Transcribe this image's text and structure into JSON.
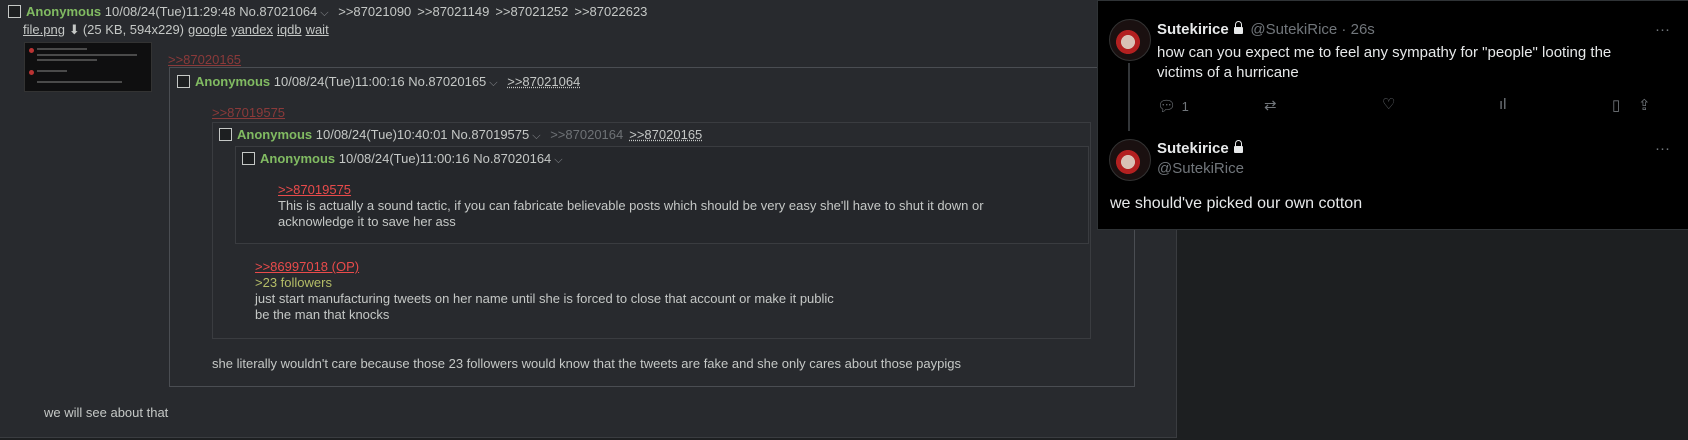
{
  "main_post": {
    "name": "Anonymous",
    "datetime": "10/08/24(Tue)11:29:48",
    "post_no": "No.87021064",
    "backlinks": [
      ">>87021090",
      ">>87021149",
      ">>87021252",
      ">>87022623"
    ],
    "file_name": "file.png",
    "file_meta": "(25 KB, 594x229)",
    "file_links": [
      "google",
      "yandex",
      "iqdb",
      "wait"
    ],
    "quote_dead": ">>87020165",
    "comment": "we will see about that"
  },
  "reply_1": {
    "name": "Anonymous",
    "datetime": "10/08/24(Tue)11:00:16",
    "post_no": "No.87020165",
    "backlink": ">>87021064",
    "quote_dead": ">>87019575",
    "comment": "she literally wouldn't care because those 23 followers would know that the tweets are fake and she only cares about those paypigs"
  },
  "reply_2": {
    "name": "Anonymous",
    "datetime": "10/08/24(Tue)10:40:01",
    "post_no": "No.87019575",
    "backlink_dim": ">>87020164",
    "backlink": ">>87020165",
    "quote_op": ">>86997018 (OP)",
    "greentext": ">23 followers",
    "comment_line1": "just start manufacturing tweets on her name until she is forced to close that account or make it public",
    "comment_line2": "be the man that knocks"
  },
  "reply_3": {
    "name": "Anonymous",
    "datetime": "10/08/24(Tue)11:00:16",
    "post_no": "No.87020164",
    "quote": ">>87019575",
    "comment": "This is actually a sound tactic, if you can fabricate believable posts which should be very easy she'll have to shut it down or acknowledge it to save her ass"
  },
  "tweet": {
    "first": {
      "display_name": "Sutekirice",
      "handle_time": "@SutekiRice · 26s",
      "text": "how can you expect me to feel any sympathy for \"people\" looting the victims of a hurricane",
      "reply_count": "1"
    },
    "second": {
      "display_name": "Sutekirice",
      "handle": "@SutekiRice",
      "text": "we should've picked our own cotton"
    },
    "icons": [
      "reply-icon",
      "retweet-icon",
      "like-icon",
      "views-icon",
      "bookmark-icon",
      "share-icon",
      "more-icon"
    ]
  }
}
